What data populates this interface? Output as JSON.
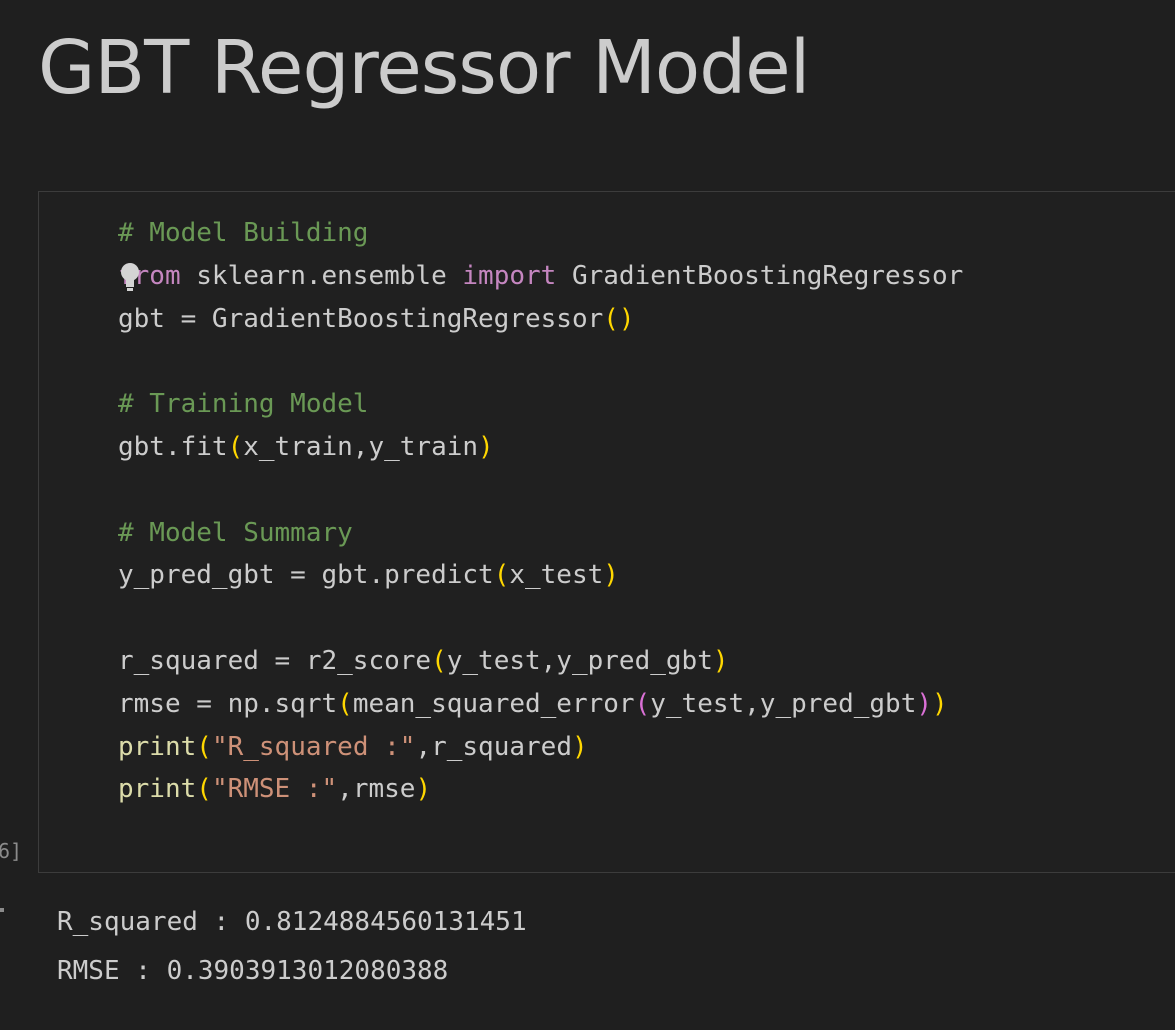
{
  "notebook": {
    "markdown_heading": "GBT Regressor Model",
    "code_cell": {
      "execution_count_label": "6]",
      "lines": [
        [
          {
            "t": "# Model Building",
            "k": "comment"
          }
        ],
        [
          {
            "t": "from",
            "k": "keyword"
          },
          {
            "t": " sklearn.ensemble ",
            "k": "plain"
          },
          {
            "t": "import",
            "k": "keyword"
          },
          {
            "t": " GradientBoostingRegressor",
            "k": "plain"
          }
        ],
        [
          {
            "t": "gbt = GradientBoostingRegressor",
            "k": "plain"
          },
          {
            "t": "()",
            "k": "paren1"
          }
        ],
        [],
        [
          {
            "t": "# Training Model",
            "k": "comment"
          }
        ],
        [
          {
            "t": "gbt.fit",
            "k": "plain"
          },
          {
            "t": "(",
            "k": "paren1"
          },
          {
            "t": "x_train,y_train",
            "k": "plain"
          },
          {
            "t": ")",
            "k": "paren1"
          }
        ],
        [],
        [
          {
            "t": "# Model Summary",
            "k": "comment"
          }
        ],
        [
          {
            "t": "y_pred_gbt = gbt.predict",
            "k": "plain"
          },
          {
            "t": "(",
            "k": "paren1"
          },
          {
            "t": "x_test",
            "k": "plain"
          },
          {
            "t": ")",
            "k": "paren1"
          }
        ],
        [],
        [
          {
            "t": "r_squared = r2_score",
            "k": "plain"
          },
          {
            "t": "(",
            "k": "paren1"
          },
          {
            "t": "y_test,y_pred_gbt",
            "k": "plain"
          },
          {
            "t": ")",
            "k": "paren1"
          }
        ],
        [
          {
            "t": "rmse = np.sqrt",
            "k": "plain"
          },
          {
            "t": "(",
            "k": "paren1"
          },
          {
            "t": "mean_squared_error",
            "k": "plain"
          },
          {
            "t": "(",
            "k": "paren2"
          },
          {
            "t": "y_test,y_pred_gbt",
            "k": "plain"
          },
          {
            "t": ")",
            "k": "paren2"
          },
          {
            "t": ")",
            "k": "paren1"
          }
        ],
        [
          {
            "t": "print",
            "k": "func"
          },
          {
            "t": "(",
            "k": "paren1"
          },
          {
            "t": "\"R_squared :\"",
            "k": "string"
          },
          {
            "t": ",r_squared",
            "k": "plain"
          },
          {
            "t": ")",
            "k": "paren1"
          }
        ],
        [
          {
            "t": "print",
            "k": "func"
          },
          {
            "t": "(",
            "k": "paren1"
          },
          {
            "t": "\"RMSE :\"",
            "k": "string"
          },
          {
            "t": ",rmse",
            "k": "plain"
          },
          {
            "t": ")",
            "k": "paren1"
          }
        ]
      ]
    },
    "output": {
      "lines": [
        "R_squared : 0.8124884560131451",
        "RMSE : 0.3903913012080388"
      ]
    },
    "icons": {
      "lightbulb": "lightbulb-icon"
    },
    "colors": {
      "background": "#1f1f1f",
      "comment": "#6a9955",
      "keyword": "#c586c0",
      "function": "#dcdcaa",
      "string": "#ce9178",
      "bracket_level1": "#ffd700",
      "bracket_level2": "#da70d6",
      "text": "#cccccc"
    }
  }
}
